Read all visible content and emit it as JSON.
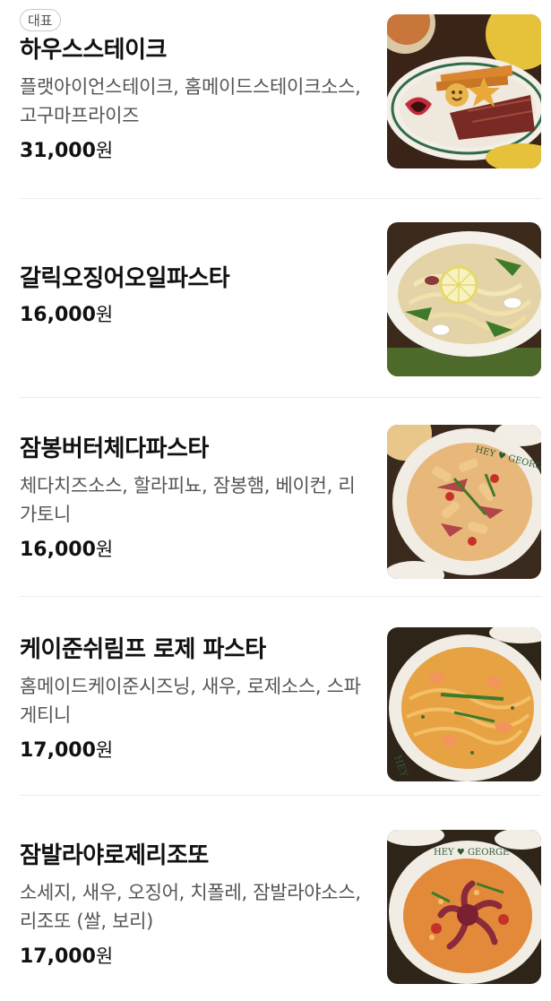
{
  "items": [
    {
      "badge": "대표",
      "name": "하우스스테이크",
      "description": "플랫아이언스테이크, 홈메이드스테이크소스, 고구마프라이즈",
      "price": "31,000",
      "currency": "원",
      "photo_icon": "steak-plate-photo"
    },
    {
      "name": "갈릭오징어오일파스타",
      "description": "",
      "price": "16,000",
      "currency": "원",
      "photo_icon": "oil-pasta-photo"
    },
    {
      "name": "잠봉버터체다파스타",
      "description": "체다치즈소스, 할라피뇨, 잠봉햄, 베이컨, 리가토니",
      "price": "16,000",
      "currency": "원",
      "photo_icon": "rigatoni-pasta-photo"
    },
    {
      "name": "케이준쉬림프 로제 파스타",
      "description": "홈메이드케이준시즈닝, 새우, 로제소스, 스파게티니",
      "price": "17,000",
      "currency": "원",
      "photo_icon": "rose-pasta-photo"
    },
    {
      "name": "잠발라야로제리조또",
      "description": "소세지, 새우, 오징어, 치폴레, 잠발라야소스, 리조또 (쌀, 보리)",
      "price": "17,000",
      "currency": "원",
      "photo_icon": "risotto-photo"
    }
  ],
  "colors": {
    "text_primary": "#111111",
    "text_secondary": "#555555",
    "divider": "#ececec",
    "badge_border": "#c9c9c9"
  }
}
